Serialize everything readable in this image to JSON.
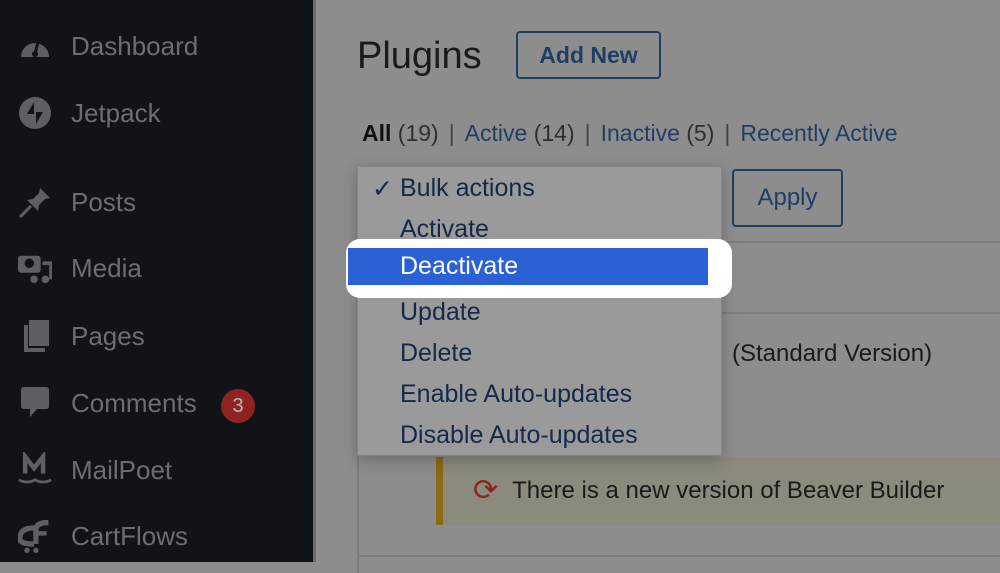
{
  "sidebar": {
    "items": [
      {
        "label": "Dashboard",
        "icon": "dashboard-icon"
      },
      {
        "label": "Jetpack",
        "icon": "jetpack-icon"
      },
      {
        "label": "Posts",
        "icon": "pin-icon"
      },
      {
        "label": "Media",
        "icon": "media-icon"
      },
      {
        "label": "Pages",
        "icon": "pages-icon"
      },
      {
        "label": "Comments",
        "icon": "comment-icon",
        "badge": "3"
      },
      {
        "label": "MailPoet",
        "icon": "mailpoet-icon"
      },
      {
        "label": "CartFlows",
        "icon": "cartflows-icon"
      }
    ]
  },
  "header": {
    "title": "Plugins",
    "add_new": "Add New"
  },
  "filters": [
    {
      "label": "All",
      "count": "(19)"
    },
    {
      "label": "Active",
      "count": "(14)"
    },
    {
      "label": "Inactive",
      "count": "(5)"
    },
    {
      "label": "Recently Active",
      "count": ""
    }
  ],
  "bulk": {
    "apply": "Apply",
    "options": [
      "Bulk actions",
      "Activate",
      "Deactivate",
      "Update",
      "Delete",
      "Enable Auto-updates",
      "Disable Auto-updates"
    ],
    "selected": "Bulk actions",
    "highlighted": "Deactivate",
    "check": "✓"
  },
  "table": {
    "plugin_name_fragment": "(Standard Version)",
    "notice": "There is a new version of Beaver Builder"
  },
  "colors": {
    "sidebar": "#101317",
    "highlight": "#2a62d6",
    "badge": "#8e2320",
    "link": "#1e3e66"
  }
}
